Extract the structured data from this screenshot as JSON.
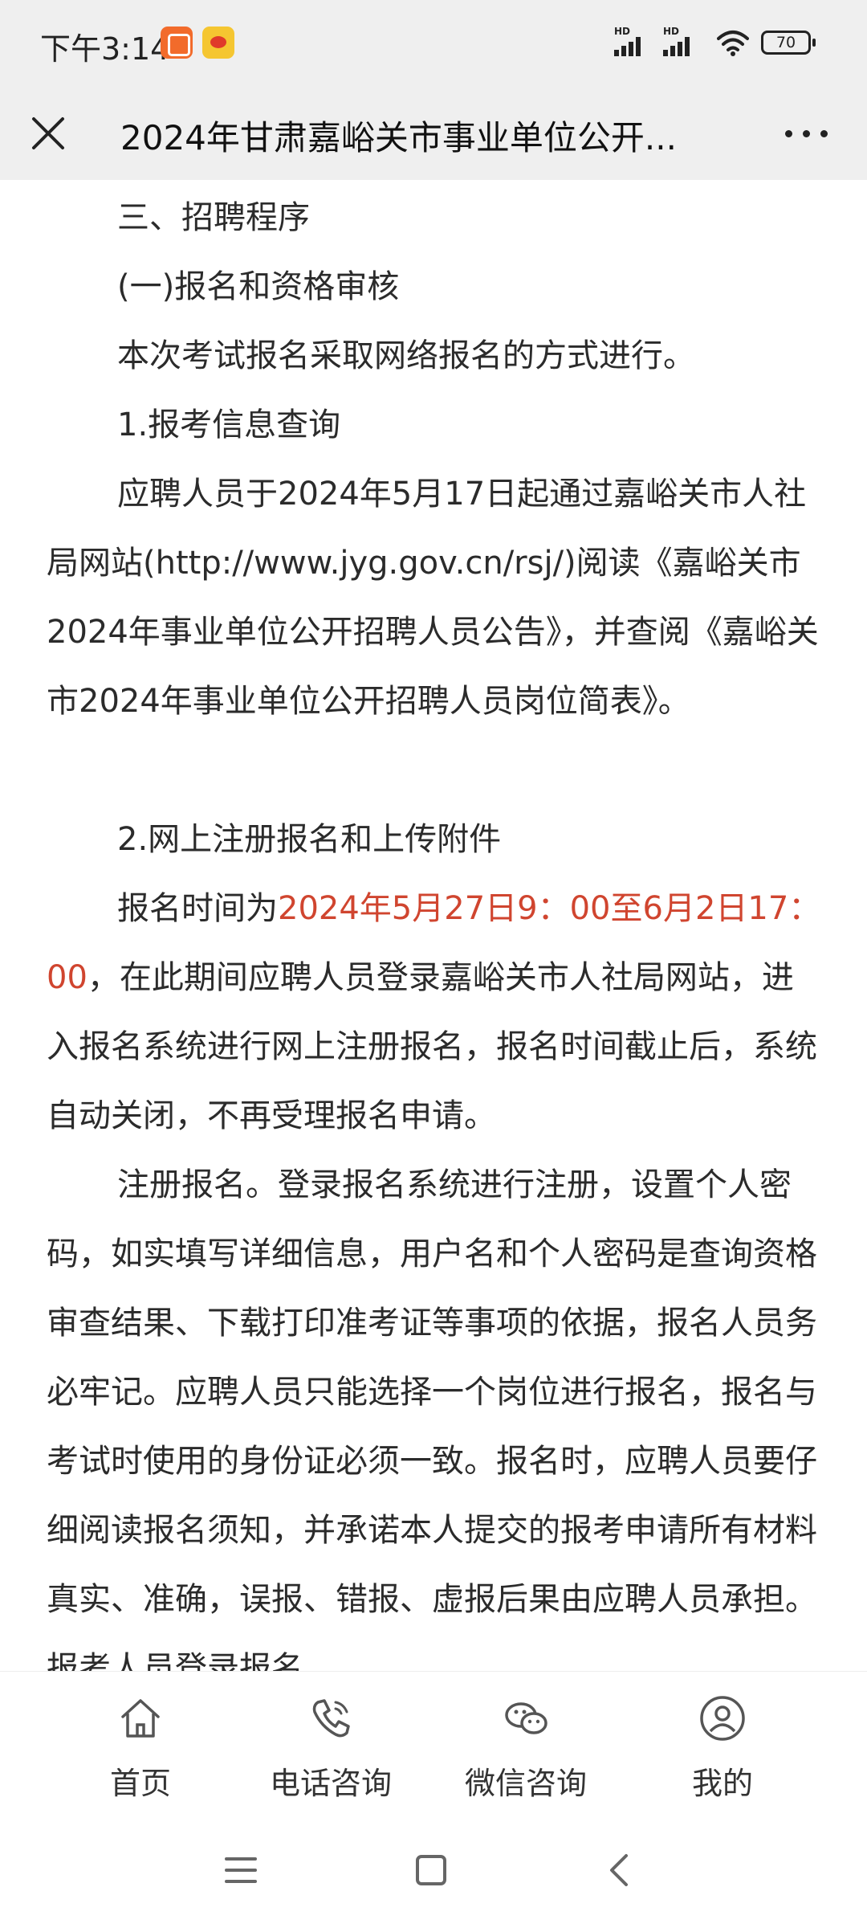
{
  "status_bar": {
    "time": "下午3:14",
    "network_1": "HD",
    "network_2": "HD",
    "battery": "70"
  },
  "header": {
    "title": "2024年甘肃嘉峪关市事业单位公开..."
  },
  "article": {
    "p1": "三、招聘程序",
    "p2": "(一)报名和资格审核",
    "p3": "本次考试报名采取网络报名的方式进行。",
    "p4": "1.报考信息查询",
    "p5": "应聘人员于2024年5月17日起通过嘉峪关市人社局网站(http://www.jyg.gov.cn/rsj/)阅读《嘉峪关市2024年事业单位公开招聘人员公告》，并查阅《嘉峪关市2024年事业单位公开招聘人员岗位简表》。",
    "p6": "2.网上注册报名和上传附件",
    "p7_prefix": "报名时间为",
    "p7_highlight": "2024年5月27日9：00至6月2日17：00",
    "p7_suffix": "，在此期间应聘人员登录嘉峪关市人社局网站，进入报名系统进行网上注册报名，报名时间截止后，系统自动关闭，不再受理报名申请。",
    "p8": "注册报名。登录报名系统进行注册，设置个人密码，如实填写详细信息，用户名和个人密码是查询资格审查结果、下载打印准考证等事项的依据，报名人员务必牢记。应聘人员只能选择一个岗位进行报名，报名与考试时使用的身份证必须一致。报名时，应聘人员要仔细阅读报名须知，并承诺本人提交的报考申请所有材料真实、准确，误报、错报、虚报后果由应聘人员承担。报考人员登录报名"
  },
  "bottom_nav": {
    "home": "首页",
    "phone": "电话咨询",
    "wechat": "微信咨询",
    "mine": "我的"
  },
  "colors": {
    "highlight": "#d0452f",
    "bar_background": "#efefef"
  }
}
